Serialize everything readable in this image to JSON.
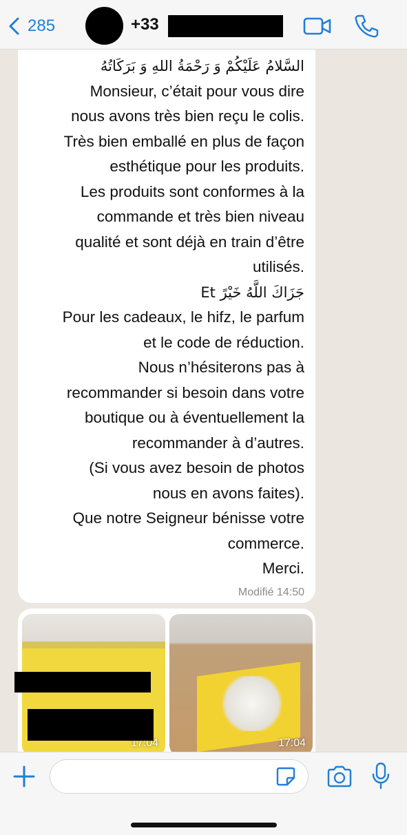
{
  "header": {
    "back_count": "285",
    "contact_prefix": "+33",
    "accent": "#1f7fd6"
  },
  "message": {
    "lines": [
      "السَّلامُ عَلَيْكُمْ وَ رَحْمَةُ اللهِ وَ بَرَكَاتُهُ",
      "Monsieur, c’était pour vous dire",
      "nous avons très bien reçu le colis.",
      "Très bien emballé en plus de façon",
      "esthétique pour les produits.",
      "Les produits sont conformes à la",
      "commande et très bien niveau",
      "qualité et sont déjà en train d’être",
      "utilisés.",
      "Et جَزَاكَ اللَّهُ خَيْرً",
      "Pour les cadeaux, le hifz, le parfum",
      "et le code de réduction.",
      "Nous n’hésiterons pas à",
      "recommander si besoin dans votre",
      "boutique ou à éventuellement la",
      "recommander à d’autres.",
      "(Si vous avez besoin de photos",
      "nous en avons faites).",
      "Que notre Seigneur bénisse votre",
      "commerce.",
      "Merci."
    ],
    "edited_label": "Modifié",
    "time": "14:50"
  },
  "media": {
    "photos": [
      {
        "time": "17:04",
        "icon": "photo-package-icon"
      },
      {
        "time": "17:04",
        "icon": "photo-yellow-box-icon"
      }
    ]
  },
  "input": {
    "placeholder": "",
    "icons": [
      "plus-icon",
      "sticker-icon",
      "camera-icon",
      "microphone-icon"
    ]
  }
}
